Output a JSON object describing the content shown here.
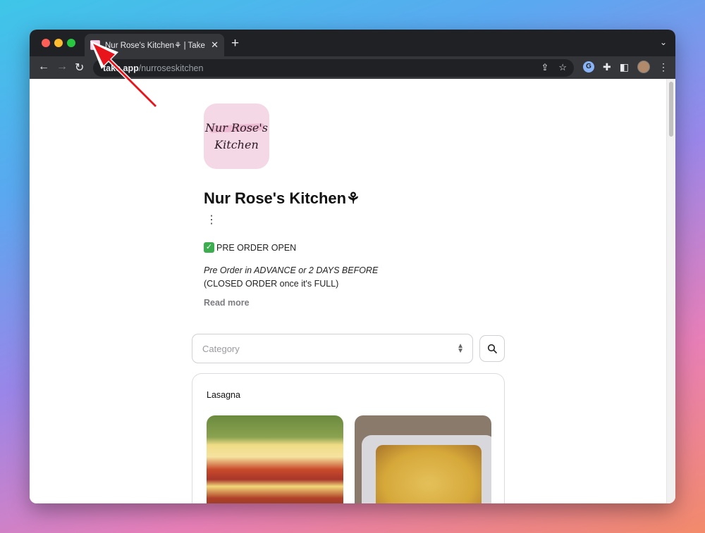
{
  "browser": {
    "tab_title": "Nur Rose's Kitchen⚘ | Take App",
    "url_host": "take.app",
    "url_path": "/nurroseskitchen"
  },
  "shop": {
    "logo_line1": "Nur Rose's",
    "logo_line2": "Kitchen",
    "name": "Nur Rose's Kitchen⚘",
    "status": "PRE ORDER OPEN",
    "description_line1": "Pre Order in ADVANCE or 2 DAYS BEFORE",
    "description_line2": "(CLOSED ORDER once it's FULL)",
    "read_more": "Read more"
  },
  "filter": {
    "category_placeholder": "Category"
  },
  "section": {
    "title": "Lasagna"
  },
  "colors": {
    "accent_arrow": "#e8141b",
    "logo_bg": "#f4d8e6"
  }
}
